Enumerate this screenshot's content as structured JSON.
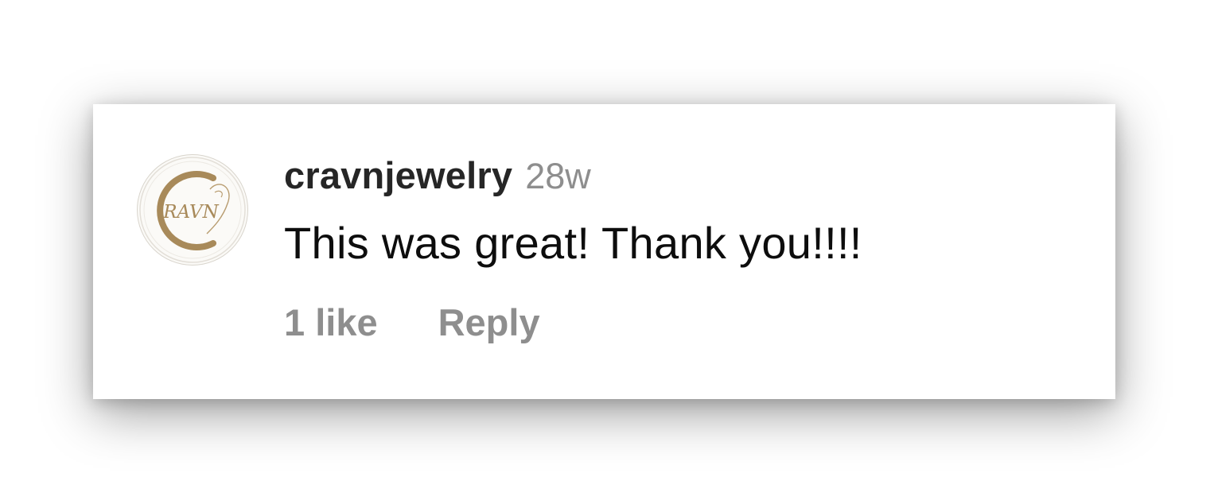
{
  "comment": {
    "avatar": {
      "icon": "cravn-logo-icon",
      "logo_text": "RAVN",
      "brand_color": "#a88a5a"
    },
    "username": "cravnjewelry",
    "timestamp": "28w",
    "text": "This was great! Thank you!!!!",
    "likes_label": "1 like",
    "reply_label": "Reply"
  },
  "colors": {
    "username": "#262626",
    "muted": "#8e8e8e",
    "text": "#0d0d0d"
  }
}
